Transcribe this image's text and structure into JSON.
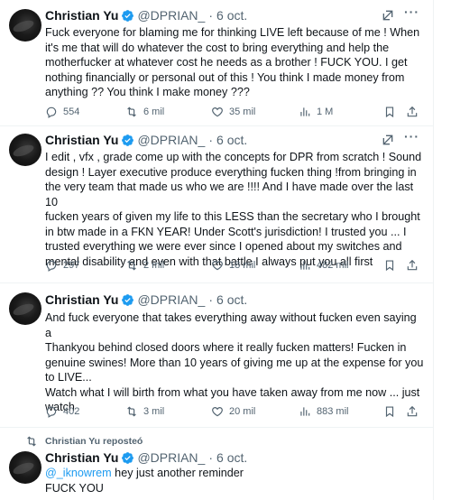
{
  "tweets": [
    {
      "name": "Christian Yu",
      "handle": "@DPRIAN_",
      "dot": "·",
      "time": "6 oct.",
      "lines": [
        "Fuck everyone for blaming me for thinking LIVE left because of me ! When",
        "it's me that will do whatever the cost to bring everything and help the",
        "motherfucker at whatever cost he needs as a brother ! FUCK YOU. I get",
        "nothing financially or personal out of this ! You think I made money from",
        "anything ?? You think I make money ???"
      ],
      "replies": "554",
      "reposts": "6 mil",
      "likes": "35 mil",
      "views": "1 M"
    },
    {
      "name": "Christian Yu",
      "handle": "@DPRIAN_",
      "dot": "·",
      "time": "6 oct.",
      "lines": [
        "I edit , vfx , grade come up with the concepts for DPR from scratch ! Sound",
        "design ! Layer executive produce everything fucken thing !from bringing in",
        "the very team that made us who we are !!!! And I have made over the last 10",
        "fucken years of given my life to this LESS than the secretary who I brought",
        "in btw made in a FKN YEAR! Under Scott's jurisdiction! I trusted you ... I",
        "trusted everything we were ever since I opened about my switches and",
        "mental disability and even with that battle I always put you all first"
      ],
      "replies": "297",
      "reposts": "2 mil",
      "likes": "18 mil",
      "views": "482 mil"
    },
    {
      "name": "Christian Yu",
      "handle": "@DPRIAN_",
      "dot": "·",
      "time": "6 oct.",
      "lines": [
        "And fuck everyone that takes everything away without fucken even saying a",
        "Thankyou behind closed doors where it really fucken matters!  Fucken in",
        "genuine swines! More than 10 years of giving me up at the expense for you",
        "to LIVE...",
        "Watch what I will birth from what you have taken away from me now ... just",
        "watch"
      ],
      "replies": "402",
      "reposts": "3 mil",
      "likes": "20 mil",
      "views": "883 mil"
    },
    {
      "name": "Christian Yu",
      "handle": "@DPRIAN_",
      "dot": "·",
      "time": "6 oct.",
      "mention": "@_iknowrem",
      "mention_rest": " hey just another reminder",
      "line2": "FUCK YOU"
    }
  ],
  "repost_label": "Christian Yu reposteó",
  "icons": {
    "verified": "verified-badge-icon",
    "grok": "grok-icon",
    "more": "more-icon",
    "reply": "reply-icon",
    "repost": "repost-icon",
    "like": "like-icon",
    "views": "views-icon",
    "bookmark": "bookmark-icon",
    "share": "share-icon"
  },
  "colors": {
    "text": "#0f1419",
    "secondary": "#536471",
    "accent": "#1d9bf0",
    "border": "#eff3f4"
  }
}
